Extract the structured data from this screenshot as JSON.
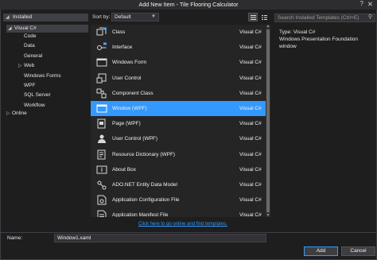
{
  "window": {
    "title": "Add New Item - Tile Flooring Calculator",
    "help_glyph": "?",
    "close_glyph": "✕"
  },
  "tree": {
    "installed": "Installed",
    "visual_csharp": "Visual C#",
    "children": [
      {
        "label": "Code",
        "expandable": false
      },
      {
        "label": "Data",
        "expandable": false
      },
      {
        "label": "General",
        "expandable": false
      },
      {
        "label": "Web",
        "expandable": true
      },
      {
        "label": "Windows Forms",
        "expandable": false
      },
      {
        "label": "WPF",
        "expandable": false
      },
      {
        "label": "SQL Server",
        "expandable": false
      },
      {
        "label": "Workflow",
        "expandable": false
      }
    ],
    "online": "Online"
  },
  "toolbar": {
    "sort_label": "Sort by:",
    "sort_value": "Default"
  },
  "templates": [
    {
      "name": "Class",
      "lang": "Visual C#",
      "icon": "class-icon",
      "selected": false
    },
    {
      "name": "Interface",
      "lang": "Visual C#",
      "icon": "interface-icon",
      "selected": false
    },
    {
      "name": "Windows Form",
      "lang": "Visual C#",
      "icon": "windows-form-icon",
      "selected": false
    },
    {
      "name": "User Control",
      "lang": "Visual C#",
      "icon": "user-control-icon",
      "selected": false
    },
    {
      "name": "Component Class",
      "lang": "Visual C#",
      "icon": "component-class-icon",
      "selected": false
    },
    {
      "name": "Window (WPF)",
      "lang": "Visual C#",
      "icon": "wpf-window-icon",
      "selected": true
    },
    {
      "name": "Page (WPF)",
      "lang": "Visual C#",
      "icon": "wpf-page-icon",
      "selected": false
    },
    {
      "name": "User Control (WPF)",
      "lang": "Visual C#",
      "icon": "wpf-user-control-icon",
      "selected": false
    },
    {
      "name": "Resource Dictionary (WPF)",
      "lang": "Visual C#",
      "icon": "resource-dictionary-icon",
      "selected": false
    },
    {
      "name": "About Box",
      "lang": "Visual C#",
      "icon": "about-box-icon",
      "selected": false
    },
    {
      "name": "ADO.NET Entity Data Model",
      "lang": "Visual C#",
      "icon": "entity-data-model-icon",
      "selected": false
    },
    {
      "name": "Application Configuration File",
      "lang": "Visual C#",
      "icon": "config-file-icon",
      "selected": false
    },
    {
      "name": "Application Manifest File",
      "lang": "Visual C#",
      "icon": "manifest-file-icon",
      "selected": false
    }
  ],
  "online_link": "Click here to go online and find templates.",
  "search": {
    "placeholder": "Search Installed Templates (Ctrl+E)"
  },
  "info": {
    "type": "Type:  Visual C#",
    "description": "Windows Presentation Foundation window"
  },
  "footer": {
    "name_label": "Name:",
    "name_value": "Window1.xaml",
    "add_label": "Add",
    "cancel_label": "Cancel"
  },
  "colors": {
    "selection": "#3399ff",
    "background": "#1e1e1e",
    "list_bg": "#252526"
  }
}
